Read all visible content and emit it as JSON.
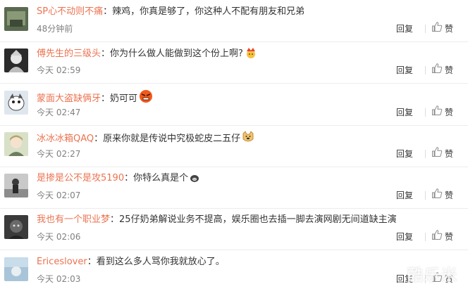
{
  "comments": [
    {
      "username": "SP心不动则不痛",
      "text": "辣鸡，你真是够了，你这种人不配有朋友和兄弟",
      "time": "48分钟前",
      "avatar_color": "#5a6a50",
      "emoji": ""
    },
    {
      "username": "傅先生的三级头",
      "text": "你为什么做人能做到这个份上啊?",
      "time": "今天 02:59",
      "avatar_color": "#2b2b2b",
      "emoji": "crown-emoji"
    },
    {
      "username": "蒙面大盗缺俩牙",
      "text": "奶可可",
      "time": "今天 02:47",
      "avatar_color": "#dfe6ee",
      "emoji": "angry-emoji"
    },
    {
      "username": "冰冰冰箱QAQ",
      "text": "原来你就是传说中究极蛇皮二五仔",
      "time": "今天 02:27",
      "avatar_color": "#d8e0c8",
      "emoji": "doge-emoji"
    },
    {
      "username": "是掺是公不是攻5190",
      "text": "你特么真是个",
      "time": "今天 02:07",
      "avatar_color": "#c9c9c9",
      "emoji": "pig-emoji"
    },
    {
      "username": "我也有一个职业梦",
      "text": "25仔奶弟解说业务不提高，娱乐圈也去插一脚去演网剧无间道缺主演",
      "time": "今天 02:06",
      "avatar_color": "#3a3a3a",
      "emoji": ""
    },
    {
      "username": "Ericeslover",
      "text": "看到这么多人骂你我就放心了。",
      "time": "今天 02:03",
      "avatar_color": "#a8c4d8",
      "emoji": ""
    }
  ],
  "actions": {
    "reply_label": "回复",
    "like_label": "赞"
  },
  "separator": "：",
  "watermark": "酷乐米",
  "colors": {
    "username": "#eb7350",
    "text": "#333333",
    "time": "#808080"
  }
}
